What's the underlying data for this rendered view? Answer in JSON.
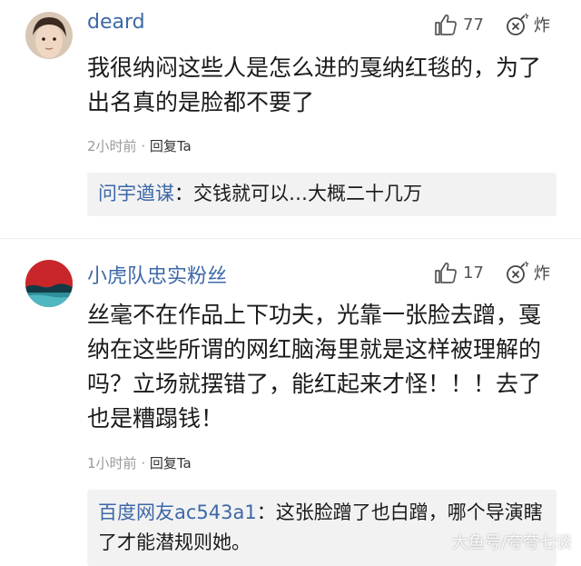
{
  "comments": [
    {
      "username": "deard",
      "likes": "77",
      "boom_label": "炸",
      "text": "我很纳闷这些人是怎么进的戛纳红毯的，为了出名真的是脸都不要了",
      "time": "2小时前",
      "separator": " · ",
      "reply_action": "回复Ta",
      "reply": {
        "user": "问宇遒谋",
        "colon": "：",
        "text": "交钱就可以…大概二十几万"
      }
    },
    {
      "username": "小虎队忠实粉丝",
      "likes": "17",
      "boom_label": "炸",
      "text": "丝毫不在作品上下功夫，光靠一张脸去蹭，戛纳在这些所谓的网红脑海里就是这样被理解的吗？立场就摆错了，能红起来才怪！！！去了也是糟蹋钱！",
      "time": "1小时前",
      "separator": " · ",
      "reply_action": "回复Ta",
      "reply": {
        "user": "百度网友ac543a1",
        "colon": "：",
        "text": "这张脸蹭了也白蹭，哪个导演瞎了才能潜规则她。"
      }
    }
  ],
  "watermark": "大鱼号/夸夸七谈",
  "colors": {
    "username": "#3d68a8",
    "meta": "#9a9a9a",
    "reply_bg": "#f2f2f2"
  },
  "icons": [
    "thumbs-up-icon",
    "bomb-icon"
  ]
}
